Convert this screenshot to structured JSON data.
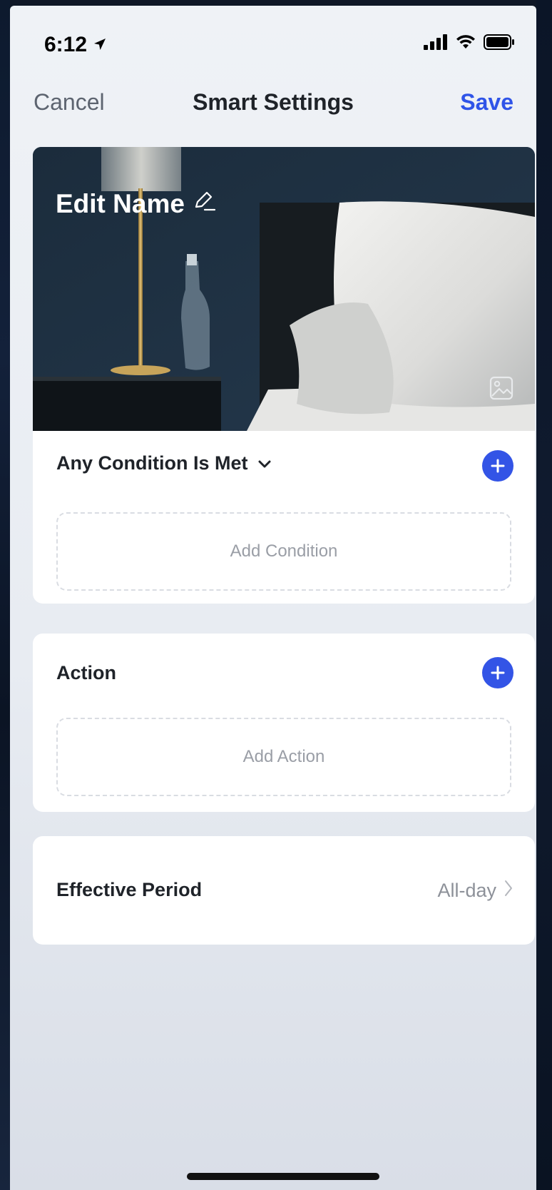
{
  "status": {
    "time": "6:12"
  },
  "nav": {
    "cancel_label": "Cancel",
    "title": "Smart Settings",
    "save_label": "Save"
  },
  "hero": {
    "name_label": "Edit Name"
  },
  "condition": {
    "header": "Any Condition Is Met",
    "placeholder": "Add Condition"
  },
  "action": {
    "header": "Action",
    "placeholder": "Add Action"
  },
  "period": {
    "label": "Effective Period",
    "value": "All-day"
  },
  "colors": {
    "accent": "#2f54e8",
    "add_button": "#3354e6"
  },
  "icons": [
    "location-arrow-icon",
    "signal-icon",
    "wifi-icon",
    "battery-icon",
    "pencil-icon",
    "image-icon",
    "chevron-down-icon",
    "plus-icon",
    "chevron-right-icon"
  ]
}
